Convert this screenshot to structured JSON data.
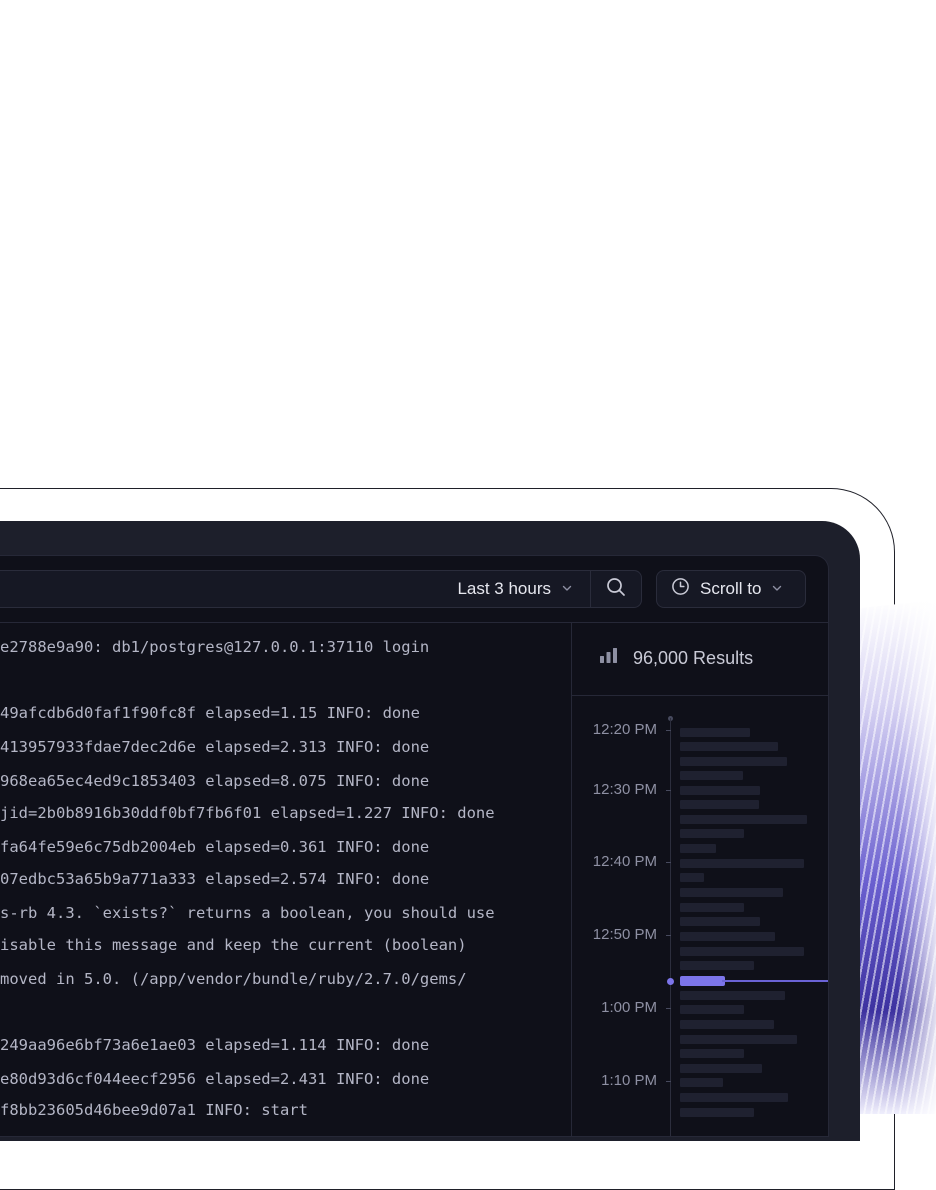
{
  "toolbar": {
    "time_range_label": "Last 3 hours",
    "scroll_to_label": "Scroll to"
  },
  "logs": [
    "e2788e9a90: db1/postgres@127.0.0.1:37110 login",
    "",
    "49afcdb6d0faf1f90fc8f elapsed=1.15 INFO: done",
    "413957933fdae7dec2d6e elapsed=2.313 INFO: done",
    "968ea65ec4ed9c1853403 elapsed=8.075 INFO: done",
    "jid=2b0b8916b30ddf0bf7fb6f01 elapsed=1.227 INFO: done",
    "fa64fe59e6c75db2004eb elapsed=0.361 INFO: done",
    "07edbc53a65b9a771a333 elapsed=2.574 INFO: done",
    "s-rb 4.3. `exists?` returns a boolean, you should use",
    "isable this message and keep the current (boolean)",
    "moved in 5.0. (/app/vendor/bundle/ruby/2.7.0/gems/",
    "",
    "249aa96e6bf73a6e1ae03 elapsed=1.114 INFO: done",
    "e80d93d6cf044eecf2956 elapsed=2.431 INFO: done",
    "f8bb23605d46bee9d07a1 INFO: start"
  ],
  "results": {
    "count_label": "96,000 Results"
  },
  "timeline": {
    "labels": [
      "12:20 PM",
      "12:30 PM",
      "12:40 PM",
      "12:50 PM",
      "1:00 PM",
      "1:10 PM"
    ],
    "accent_color": "#7c75ea"
  },
  "icons": {
    "time_range_chevron": "chevron-down-icon",
    "search": "search-icon",
    "clock": "clock-icon",
    "scroll_chevron": "chevron-down-icon",
    "results": "bar-chart-icon"
  }
}
